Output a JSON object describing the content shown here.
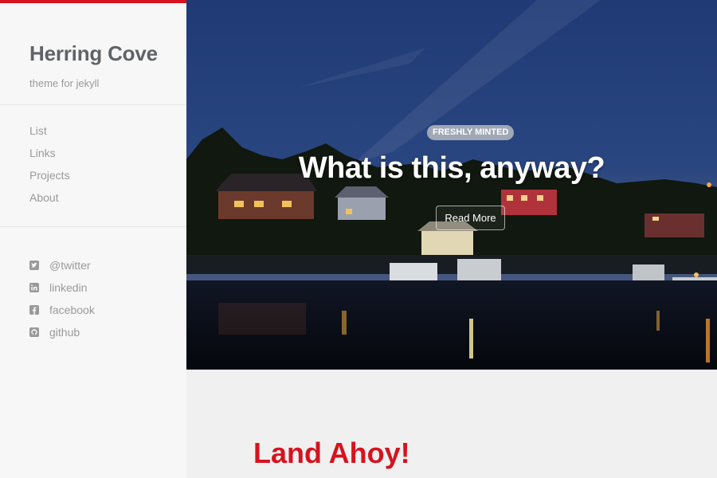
{
  "brand": {
    "title": "Herring Cove",
    "tagline": "theme for jekyll",
    "accent": "#d6131e"
  },
  "nav": {
    "items": [
      {
        "label": "List"
      },
      {
        "label": "Links"
      },
      {
        "label": "Projects"
      },
      {
        "label": "About"
      }
    ]
  },
  "social": {
    "items": [
      {
        "label": "@twitter",
        "icon": "twitter-icon"
      },
      {
        "label": "linkedin",
        "icon": "linkedin-icon"
      },
      {
        "label": "facebook",
        "icon": "facebook-icon"
      },
      {
        "label": "github",
        "icon": "github-icon"
      }
    ]
  },
  "hero": {
    "badge": "FRESHLY MINTED",
    "title": "What is this, anyway?",
    "button": "Read More"
  },
  "post": {
    "title": "Land Ahoy!"
  }
}
